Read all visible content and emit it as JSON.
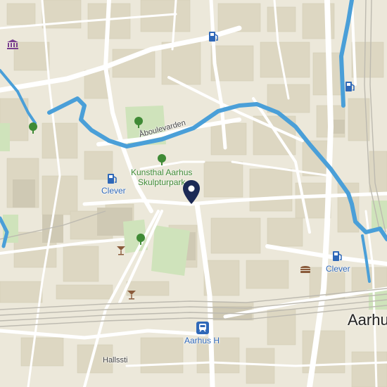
{
  "map": {
    "labels": {
      "road_aboulevarden": "Åboulevarden",
      "park_name_line1": "Kunsthal Aarhus",
      "park_name_line2": "Skulpturpark",
      "fuel_clever_1": "Clever",
      "fuel_clever_2": "Clever",
      "station": "Aarhus H",
      "city": "Aarhus",
      "road_hallssti": "Hallssti"
    },
    "icons": [
      "museum-icon",
      "fuel-station-icon",
      "tree-icon",
      "location-pin-icon",
      "cocktail-bar-icon",
      "fast-food-icon",
      "train-station-icon"
    ],
    "colors": {
      "land": "#ece8da",
      "building": "#ddd7c2",
      "road": "#ffffff",
      "water": "#4a9fd8",
      "park": "#cfe3bb",
      "rail": "#bdbab0",
      "pin": "#1c2a55",
      "poi_blue": "#2f68b8",
      "poi_green": "#3f8a35",
      "poi_brown": "#8a5a3a"
    }
  }
}
